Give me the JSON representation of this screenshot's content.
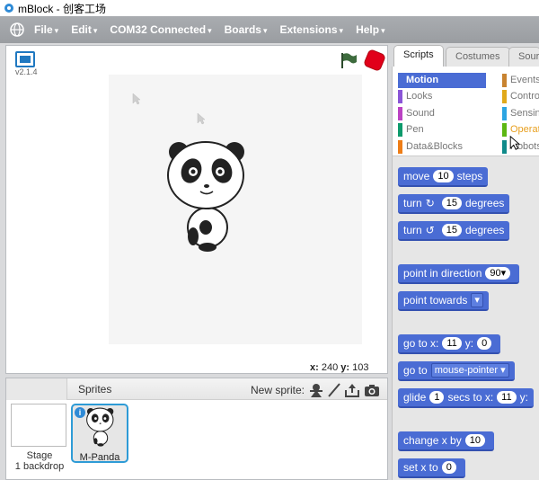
{
  "window": {
    "title": "mBlock - 创客工场"
  },
  "menu": [
    {
      "label": "File"
    },
    {
      "label": "Edit"
    },
    {
      "label": "COM32 Connected"
    },
    {
      "label": "Boards"
    },
    {
      "label": "Extensions"
    },
    {
      "label": "Help"
    }
  ],
  "menu_caret": "▾",
  "stage": {
    "version": "v2.1.4",
    "x_label": "x:",
    "x_value": "240",
    "y_label": "y:",
    "y_value": "103"
  },
  "sprites": {
    "title": "Sprites",
    "new_sprite_label": "New sprite:",
    "stage_name": "Stage",
    "stage_backdrops": "1 backdrop",
    "sprite_name": "M-Panda",
    "info_glyph": "i"
  },
  "tabs": [
    {
      "label": "Scripts",
      "active": true
    },
    {
      "label": "Costumes",
      "active": false
    },
    {
      "label": "Sour",
      "active": false
    }
  ],
  "categories_left": [
    {
      "label": "Motion",
      "color": "#4a6cd4",
      "selected": true
    },
    {
      "label": "Looks",
      "color": "#8a55d7",
      "selected": false
    },
    {
      "label": "Sound",
      "color": "#bb42c3",
      "selected": false
    },
    {
      "label": "Pen",
      "color": "#0e9a6c",
      "selected": false
    },
    {
      "label": "Data&Blocks",
      "color": "#ee7d16",
      "selected": false
    }
  ],
  "categories_right": [
    {
      "label": "Events",
      "color": "#c88330"
    },
    {
      "label": "Contro",
      "color": "#e1a91a"
    },
    {
      "label": "Sensin",
      "color": "#2ca5e2"
    },
    {
      "label": "Operat",
      "color": "#5cb712"
    },
    {
      "label": "Robots",
      "color": "#0f8a8a"
    }
  ],
  "blocks": {
    "move": {
      "pre": "move",
      "num": "10",
      "post": "steps"
    },
    "turn_cw": {
      "pre": "turn",
      "glyph": "↻",
      "num": "15",
      "post": "degrees"
    },
    "turn_ccw": {
      "pre": "turn",
      "glyph": "↺",
      "num": "15",
      "post": "degrees"
    },
    "point_dir": {
      "pre": "point in direction",
      "num": "90▾"
    },
    "point_towards": {
      "pre": "point towards",
      "drop": "▾"
    },
    "goto_xy": {
      "pre": "go to x:",
      "x": "11",
      "mid": "y:",
      "y": "0"
    },
    "goto": {
      "pre": "go to",
      "drop": "mouse-pointer ▾"
    },
    "glide": {
      "pre": "glide",
      "secs": "1",
      "mid": "secs to x:",
      "x": "11",
      "tail": "y:"
    },
    "change_x": {
      "pre": "change x by",
      "num": "10"
    },
    "set_x": {
      "pre": "set x to",
      "num": "0"
    }
  },
  "colors": {
    "motion": "#4a6cd4",
    "stop": "#e1001a",
    "flag": "#3d6b3d"
  }
}
